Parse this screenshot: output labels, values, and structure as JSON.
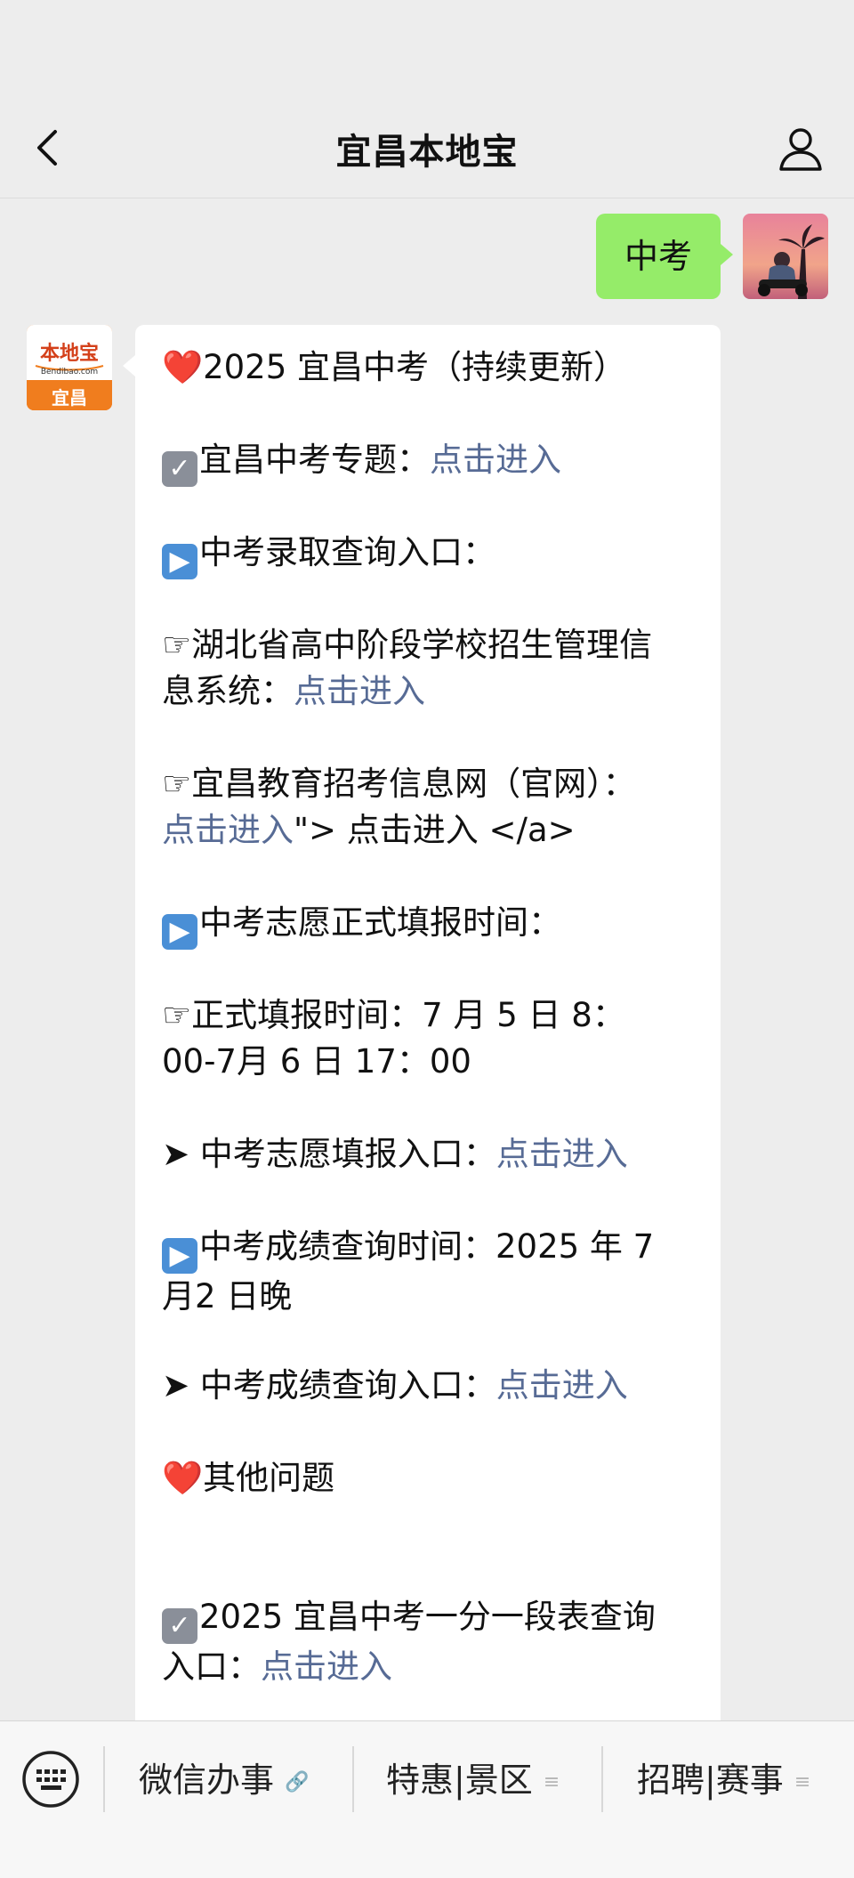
{
  "header": {
    "title": "宜昌本地宝"
  },
  "conversation": {
    "sent": {
      "text": "中考"
    },
    "received": {
      "avatar_brand": "本地宝",
      "avatar_domain": "Bendibao.com",
      "avatar_city": "宜昌",
      "lines": [
        {
          "icon": "❤️",
          "text": "2025 宜昌中考（持续更新）"
        },
        {
          "icon": "☑️",
          "text": "宜昌中考专题：",
          "link": "点击进入"
        },
        {
          "icon": "▶️",
          "text": "中考录取查询入口："
        },
        {
          "icon": "☞",
          "text_line1": "湖北省高中阶段学校招生管理信",
          "text_line2": "息系统：",
          "link": "点击进入"
        },
        {
          "icon": "☞",
          "text_line1": "宜昌教育招考信息网（官网）：",
          "link": "点击进入",
          "after_link": "\"> 点击进入 </a>"
        },
        {
          "icon": "▶️",
          "text": "中考志愿正式填报时间："
        },
        {
          "icon": "☞",
          "text_line1": "正式填报时间：7 月 5 日 8：",
          "text_line2": "00-7月 6 日 17：00"
        },
        {
          "icon": "➤",
          "text": "中考志愿填报入口：",
          "link": "点击进入"
        },
        {
          "icon": "▶️",
          "text_line1": "中考成绩查询时间：2025 年 7",
          "text_line2": "月2 日晚"
        },
        {
          "icon": "➤",
          "text": "中考成绩查询入口：",
          "link": "点击进入"
        },
        {
          "icon": "❤️",
          "text": "其他问题"
        },
        {
          "icon": "☑️",
          "text_line1": "2025 宜昌中考一分一段表查询",
          "text_line2": "入口：",
          "link": "点击进入"
        }
      ]
    }
  },
  "menu": {
    "items": [
      {
        "label": "微信办事",
        "icon": "link-icon"
      },
      {
        "label": "特惠|景区",
        "icon": "menu-lines-icon"
      },
      {
        "label": "招聘|赛事",
        "icon": "menu-lines-icon"
      }
    ]
  },
  "colors": {
    "background": "#ededed",
    "sent_bubble": "#95ec69",
    "link": "#576b95",
    "brand_orange": "#f07d1e"
  }
}
